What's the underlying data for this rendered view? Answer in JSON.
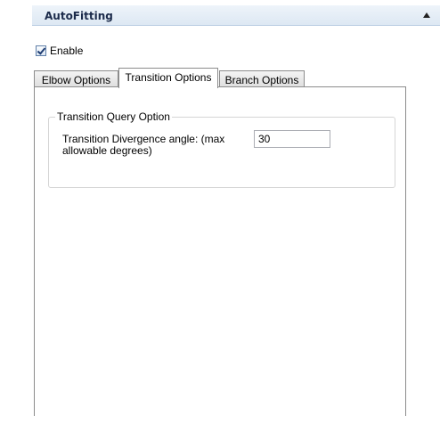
{
  "panel": {
    "title": "AutoFitting"
  },
  "enable": {
    "label": "Enable",
    "checked": true
  },
  "tabs": [
    {
      "label": "Elbow Options",
      "active": false
    },
    {
      "label": "Transition Options",
      "active": true
    },
    {
      "label": "Branch Options",
      "active": false
    }
  ],
  "transition": {
    "group_title": "Transition Query Option",
    "field_label": "Transition Divergence angle: (max allowable degrees)",
    "field_value": "30"
  },
  "colors": {
    "header_bg": "#dde8f3",
    "header_text": "#1b2a4a",
    "border": "#8c8c8c"
  }
}
